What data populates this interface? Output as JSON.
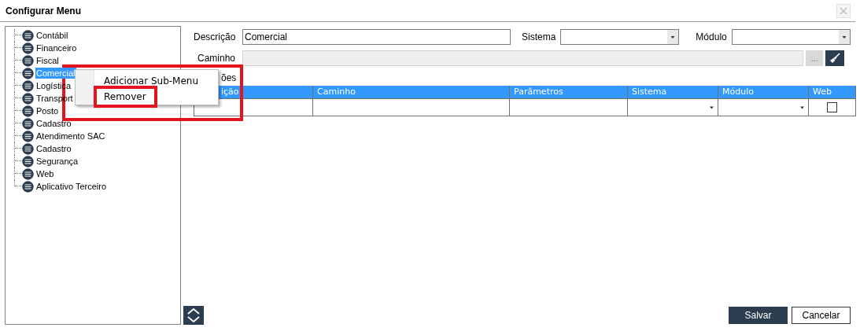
{
  "window": {
    "title": "Configurar Menu"
  },
  "tree": {
    "items": [
      {
        "label": "Contábil",
        "selected": false
      },
      {
        "label": "Financeiro",
        "selected": false
      },
      {
        "label": "Fiscal",
        "selected": false
      },
      {
        "label": "Comercial",
        "selected": true
      },
      {
        "label": "Logística",
        "selected": false
      },
      {
        "label": "Transport",
        "selected": false
      },
      {
        "label": "Posto",
        "selected": false
      },
      {
        "label": "Cadastro",
        "selected": false
      },
      {
        "label": "Atendimento SAC",
        "selected": false
      },
      {
        "label": "Cadastro",
        "selected": false
      },
      {
        "label": "Segurança",
        "selected": false
      },
      {
        "label": "Web",
        "selected": false
      },
      {
        "label": "Aplicativo Terceiro",
        "selected": false
      }
    ]
  },
  "form": {
    "descricao": {
      "label": "Descrição",
      "value": "Comercial"
    },
    "sistema": {
      "label": "Sistema"
    },
    "modulo": {
      "label": "Módulo"
    },
    "caminho": {
      "label": "Caminho",
      "disabled": true
    },
    "browse_button": "...",
    "section_label": "ões"
  },
  "table": {
    "columns": [
      "ição",
      "Caminho",
      "Parâmetros",
      "Sistema",
      "Módulo",
      "Web"
    ],
    "rows": [
      {
        "cells": [
          {
            "kind": "text"
          },
          {
            "kind": "text"
          },
          {
            "kind": "text"
          },
          {
            "kind": "select"
          },
          {
            "kind": "select"
          },
          {
            "kind": "checkbox",
            "checked": false
          }
        ]
      }
    ]
  },
  "context_menu": {
    "items": [
      {
        "label": "Adicionar Sub-Menu",
        "marked": false
      },
      {
        "label": "Remover",
        "marked": true
      }
    ],
    "marked": true
  },
  "buttons": [
    {
      "label": "Salvar",
      "kind": "primary"
    },
    {
      "label": "Cancelar",
      "kind": "secondary"
    }
  ]
}
